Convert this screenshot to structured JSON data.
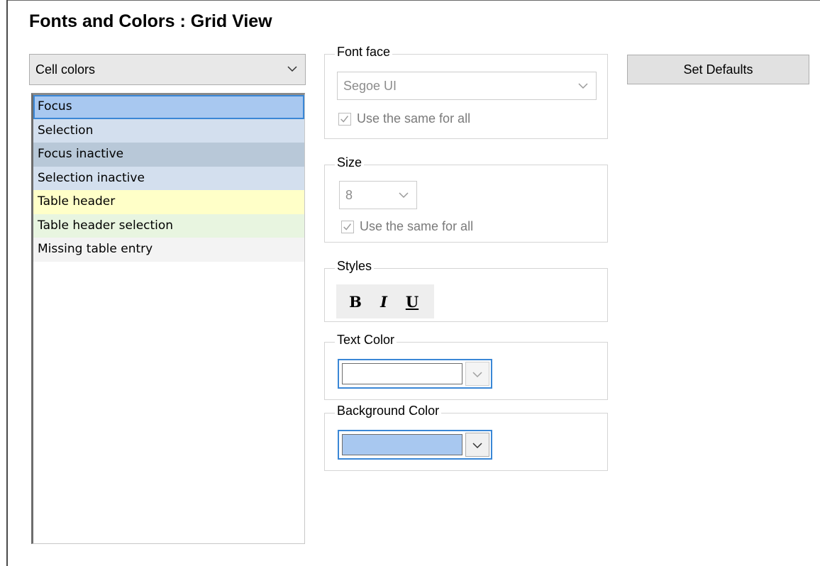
{
  "page_title": "Fonts and Colors : Grid View",
  "category": {
    "selected": "Cell colors",
    "icon": "chevron-down-icon"
  },
  "items": [
    {
      "label": "Focus",
      "bg": "#a8c8f0",
      "focused": true
    },
    {
      "label": "Selection",
      "bg": "#d3dfee"
    },
    {
      "label": "Focus inactive",
      "bg": "#b8c8d8"
    },
    {
      "label": "Selection inactive",
      "bg": "#d3dfee"
    },
    {
      "label": "Table header",
      "bg": "#ffffc8"
    },
    {
      "label": "Table header selection",
      "bg": "#e8f5e0"
    },
    {
      "label": "Missing table entry",
      "bg": "#f3f3f3"
    }
  ],
  "font_face": {
    "label": "Font face",
    "value": "Segoe UI",
    "same_for_all": "Use the same for all",
    "checked": true
  },
  "size": {
    "label": "Size",
    "value": "8",
    "same_for_all": "Use the same for all",
    "checked": true
  },
  "styles": {
    "label": "Styles",
    "bold": "B",
    "italic": "I",
    "underline": "U"
  },
  "text_color": {
    "label": "Text Color",
    "color": "#ffffff"
  },
  "background_color": {
    "label": "Background Color",
    "color": "#a8c8f0"
  },
  "set_defaults_label": "Set Defaults",
  "colors": {
    "accent": "#3a87d6",
    "disabled_text": "#8c8c8c"
  }
}
